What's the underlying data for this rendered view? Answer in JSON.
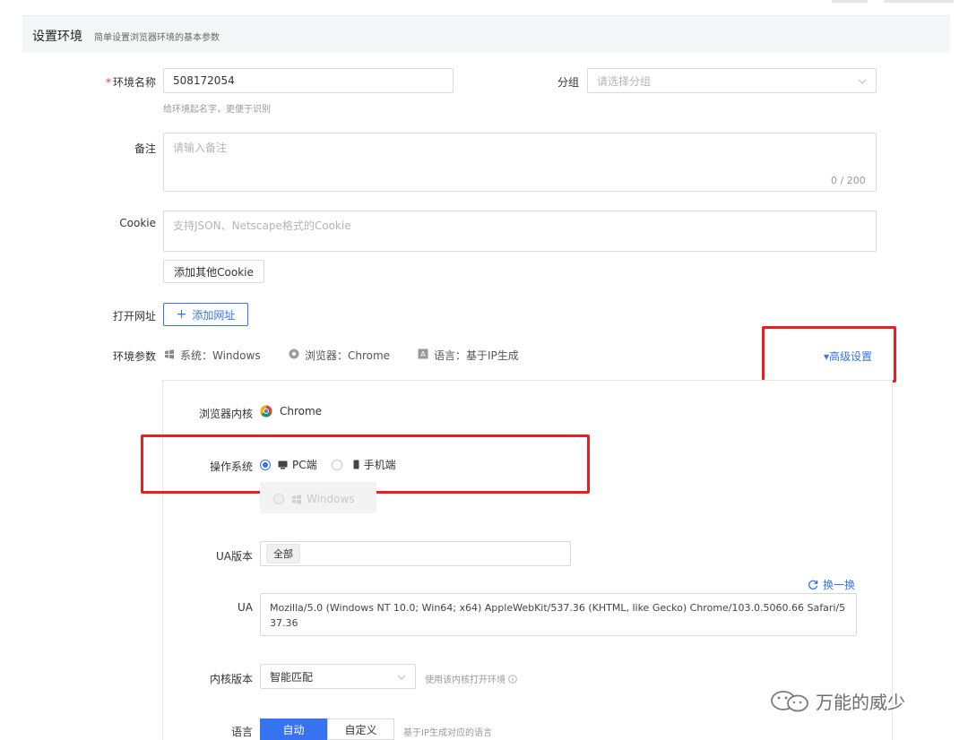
{
  "header": {
    "title": "设置环境",
    "description": "简单设置浏览器环境的基本参数"
  },
  "form": {
    "env_name": {
      "required_mark": "*",
      "label": "环境名称",
      "value": "508172054",
      "hint": "给环境起名字，更便于识别"
    },
    "group": {
      "label": "分组",
      "placeholder": "请选择分组"
    },
    "remark": {
      "label": "备注",
      "placeholder": "请输入备注",
      "counter": "0 / 200"
    },
    "cookie": {
      "label": "Cookie",
      "placeholder": "支持JSON、Netscape格式的Cookie",
      "add_button": "添加其他Cookie"
    },
    "open_url": {
      "label": "打开网址",
      "add_button": "添加网址"
    },
    "env_params": {
      "label": "环境参数",
      "system": "系统：Windows",
      "browser": "浏览器：Chrome",
      "language": "语言：基于IP生成",
      "advanced": "▾高级设置"
    }
  },
  "advanced": {
    "kernel": {
      "label": "浏览器内核",
      "value": "Chrome"
    },
    "os": {
      "label": "操作系统",
      "pc": "PC端",
      "mobile": "手机端",
      "sub_option": "Windows"
    },
    "ua_version": {
      "label": "UA版本",
      "tag": "全部"
    },
    "refresh": "换一换",
    "ua": {
      "label": "UA",
      "value": "Mozilla/5.0 (Windows NT 10.0; Win64; x64) AppleWebKit/537.36 (KHTML, like Gecko) Chrome/103.0.5060.66 Safari/537.36"
    },
    "kernel_version": {
      "label": "内核版本",
      "value": "智能匹配",
      "hint": "使用该内核打开环境"
    },
    "language": {
      "label": "语言",
      "auto": "自动",
      "custom": "自定义",
      "hint": "基于IP生成对应的语言"
    }
  },
  "watermark": {
    "text": "万能的威少"
  },
  "colors": {
    "primary": "#3773f0",
    "annotation_red": "#e81f1f"
  }
}
